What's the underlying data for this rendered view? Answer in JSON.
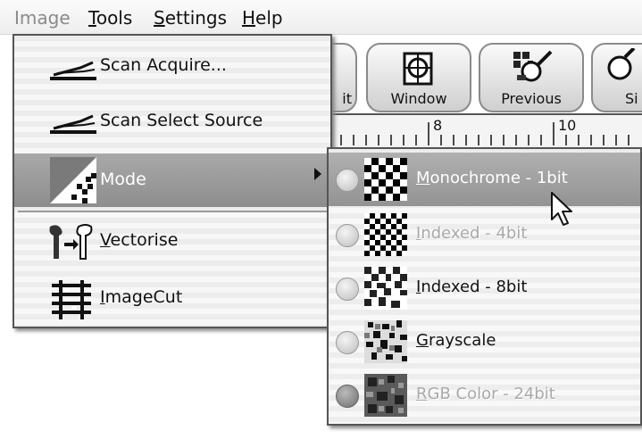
{
  "menubar": {
    "items": [
      {
        "label": "Image",
        "underline": "I",
        "rest": "mage"
      },
      {
        "label": "Tools",
        "underline": "T",
        "rest": "ools"
      },
      {
        "label": "Settings",
        "underline": "S",
        "rest": "ettings"
      },
      {
        "label": "Help",
        "underline": "H",
        "rest": "elp"
      }
    ]
  },
  "toolbar": {
    "edit_fragment": "it",
    "window_label": "Window",
    "previous_label": "Previous",
    "next_fragment": "Si"
  },
  "ruler": {
    "marks": [
      "8",
      "10"
    ]
  },
  "image_menu": {
    "items": [
      {
        "label": "Scan Acquire..."
      },
      {
        "label": "Scan Select Source"
      },
      {
        "label": "Mode"
      },
      {
        "label": "Vectorise",
        "underline": "V",
        "rest": "ectorise"
      },
      {
        "label": "ImageCut",
        "underline": "I",
        "rest": "mageCut"
      }
    ]
  },
  "mode_submenu": {
    "items": [
      {
        "label": "Monochrome - 1bit",
        "underline": "M",
        "rest": "onochrome - 1bit",
        "enabled": true
      },
      {
        "label": "Indexed - 4bit",
        "underline": "I",
        "rest": "ndexed - 4bit",
        "enabled": false
      },
      {
        "label": "Indexed - 8bit",
        "underline": "I",
        "rest": "ndexed - 8bit",
        "enabled": true
      },
      {
        "label": "Grayscale",
        "underline": "G",
        "rest": "rayscale",
        "enabled": true
      },
      {
        "label": "RGB Color - 24bit",
        "underline": "R",
        "rest": "GB Color - 24bit",
        "enabled": false
      }
    ]
  },
  "colors": {
    "highlight": "#9a9a9a",
    "menu_bg": "#f0f0f0",
    "disabled_text": "#a9a9a9"
  }
}
